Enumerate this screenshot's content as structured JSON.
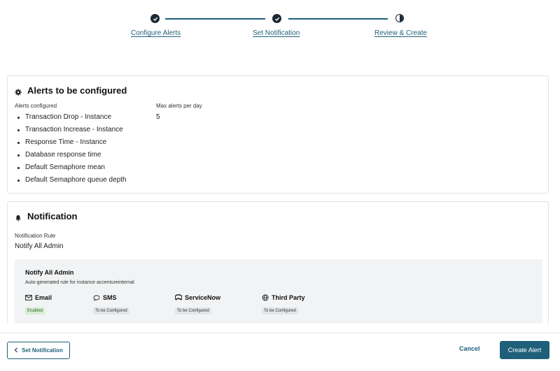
{
  "stepper": {
    "steps": [
      {
        "label": "Configure Alerts",
        "state": "completed",
        "icon": "check-icon"
      },
      {
        "label": "Set Notification",
        "state": "completed",
        "icon": "check-icon"
      },
      {
        "label": "Review & Create",
        "state": "current",
        "icon": "half-circle-icon"
      }
    ]
  },
  "alerts_panel": {
    "title": "Alerts to be configured",
    "icon": "gear-icon",
    "alerts_label": "Alerts configured",
    "alerts": [
      "Transaction Drop - Instance",
      "Transaction Increase  - Instance",
      "Response Time - Instance",
      "Database response time",
      "Default Semaphore mean",
      "Default Semaphore queue depth"
    ],
    "max_label": "Max alerts per day",
    "max_value": "5"
  },
  "notification_panel": {
    "title": "Notification",
    "icon": "bell-icon",
    "rule_label": "Notification Rule",
    "rule_value": "Notify All Admin",
    "rule_box": {
      "title": "Notify All Admin",
      "subtitle": "Auto-generated rule for instance accentureinternal",
      "channels": [
        {
          "name": "Email",
          "icon": "mail-icon",
          "status": "Enabled"
        },
        {
          "name": "SMS",
          "icon": "chat-bubble-icon",
          "status": "To be Configured"
        },
        {
          "name": "ServiceNow",
          "icon": "servicenow-icon",
          "status": "To be Configured"
        },
        {
          "name": "Third Party",
          "icon": "globe-icon",
          "status": "To be Configured"
        }
      ]
    }
  },
  "footer": {
    "back_label": "Set Notification",
    "cancel_label": "Cancel",
    "create_label": "Create Alert"
  },
  "colors": {
    "accent": "#1f5f7a",
    "step_dark": "#1d2a36",
    "enabled_badge_bg": "#d7ecd2",
    "rule_box_bg": "#f2f3f4"
  }
}
